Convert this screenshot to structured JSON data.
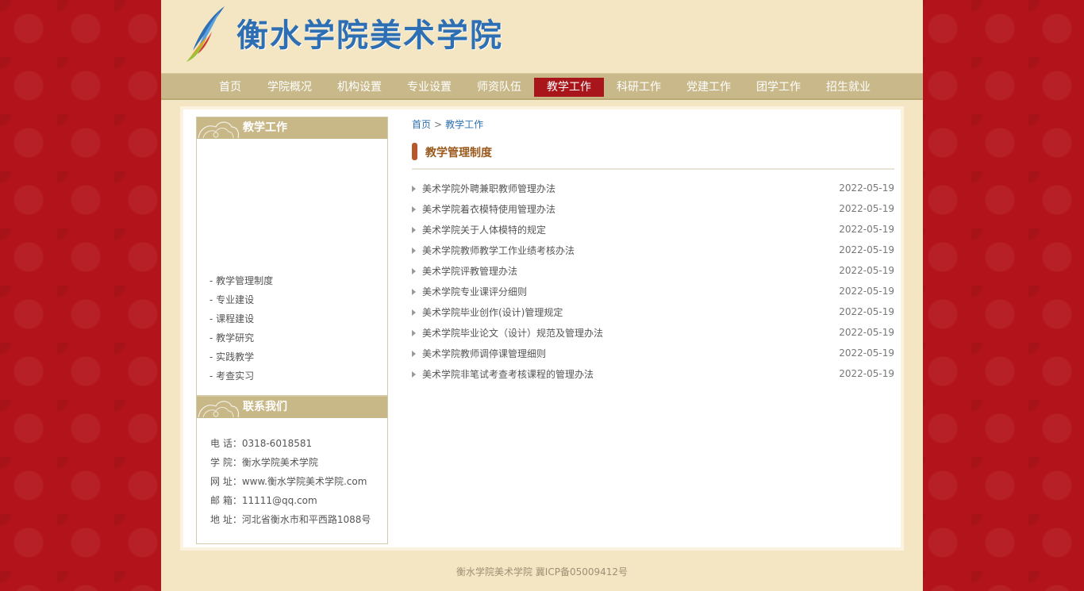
{
  "header": {
    "title": "衡水学院美术学院"
  },
  "nav": {
    "items": [
      {
        "label": "首页"
      },
      {
        "label": "学院概况"
      },
      {
        "label": "机构设置"
      },
      {
        "label": "专业设置"
      },
      {
        "label": "师资队伍"
      },
      {
        "label": "教学工作",
        "active": true
      },
      {
        "label": "科研工作"
      },
      {
        "label": "党建工作"
      },
      {
        "label": "团学工作"
      },
      {
        "label": "招生就业"
      }
    ]
  },
  "sidebar": {
    "section_title": "教学工作",
    "links": [
      "- 教学管理制度",
      "- 专业建设",
      "- 课程建设",
      "- 教学研究",
      "- 实践教学",
      "- 考查实习"
    ],
    "contact_title": "联系我们",
    "contact": [
      "电 话：0318-6018581",
      "学 院：衡水学院美术学院",
      "网 址：www.衡水学院美术学院.com",
      "邮 箱：11111@qq.com",
      "地 址：河北省衡水市和平西路1088号"
    ]
  },
  "breadcrumb": {
    "home": "首页",
    "separator": ">",
    "current": "教学工作"
  },
  "main": {
    "section_title": "教学管理制度",
    "articles": [
      {
        "title": "美术学院外聘兼职教师管理办法",
        "date": "2022-05-19"
      },
      {
        "title": "美术学院着衣模特使用管理办法",
        "date": "2022-05-19"
      },
      {
        "title": "美术学院关于人体模特的规定",
        "date": "2022-05-19"
      },
      {
        "title": "美术学院教师教学工作业绩考核办法",
        "date": "2022-05-19"
      },
      {
        "title": "美术学院评教管理办法",
        "date": "2022-05-19"
      },
      {
        "title": "美术学院专业课评分细则",
        "date": "2022-05-19"
      },
      {
        "title": "美术学院毕业创作(设计)管理规定",
        "date": "2022-05-19"
      },
      {
        "title": "美术学院毕业论文（设计）规范及管理办法",
        "date": "2022-05-19"
      },
      {
        "title": "美术学院教师调停课管理细则",
        "date": "2022-05-19"
      },
      {
        "title": "美术学院非笔试考查考核课程的管理办法",
        "date": "2022-05-19"
      }
    ]
  },
  "footer": {
    "text": "衡水学院美术学院 冀ICP备05009412号"
  },
  "colors": {
    "background_red": "#b3141b",
    "page_beige": "#f5e6c3",
    "nav_tan": "#c9b98a",
    "nav_active": "#a8151b",
    "title_blue": "#2d6fb2"
  },
  "icons": {
    "logo": "brush-logo-icon",
    "header_ornament": "cloud-ornament-icon",
    "bullet": "triangle-bullet-icon"
  }
}
